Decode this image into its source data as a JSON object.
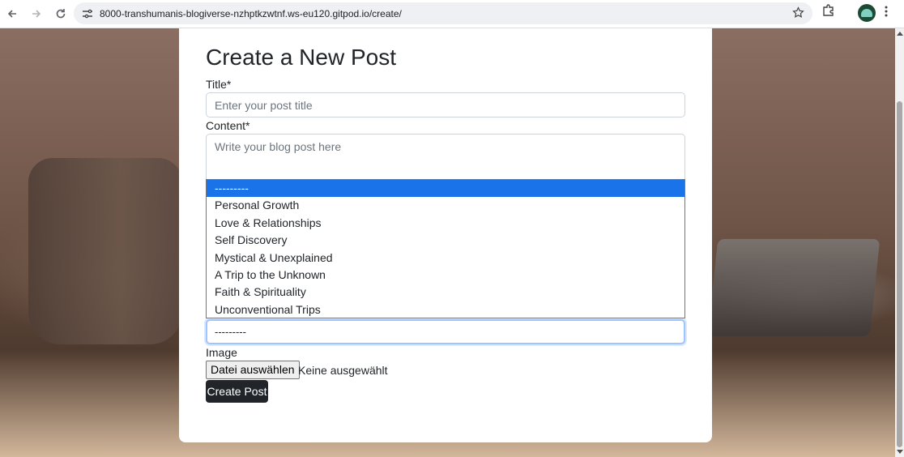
{
  "browser": {
    "url": "8000-transhumanis-blogiverse-nzhptkzwtnf.ws-eu120.gitpod.io/create/"
  },
  "form": {
    "heading": "Create a New Post",
    "title_label": "Title*",
    "title_placeholder": "Enter your post title",
    "content_label": "Content*",
    "content_placeholder": "Write your blog post here",
    "category_selected": "---------",
    "image_label": "Image",
    "file_button": "Datei auswählen",
    "file_status": "Keine ausgewählt",
    "submit_label": "Create Post"
  },
  "dropdown": {
    "options": [
      "---------",
      "Personal Growth",
      "Love & Relationships",
      "Self Discovery",
      "Mystical & Unexplained",
      "A Trip to the Unknown",
      "Faith & Spirituality",
      "Unconventional Trips"
    ],
    "highlighted_index": 0
  },
  "colors": {
    "highlight": "#1a73e8",
    "button_dark": "#212529",
    "focus_border": "#9ec5fe"
  }
}
